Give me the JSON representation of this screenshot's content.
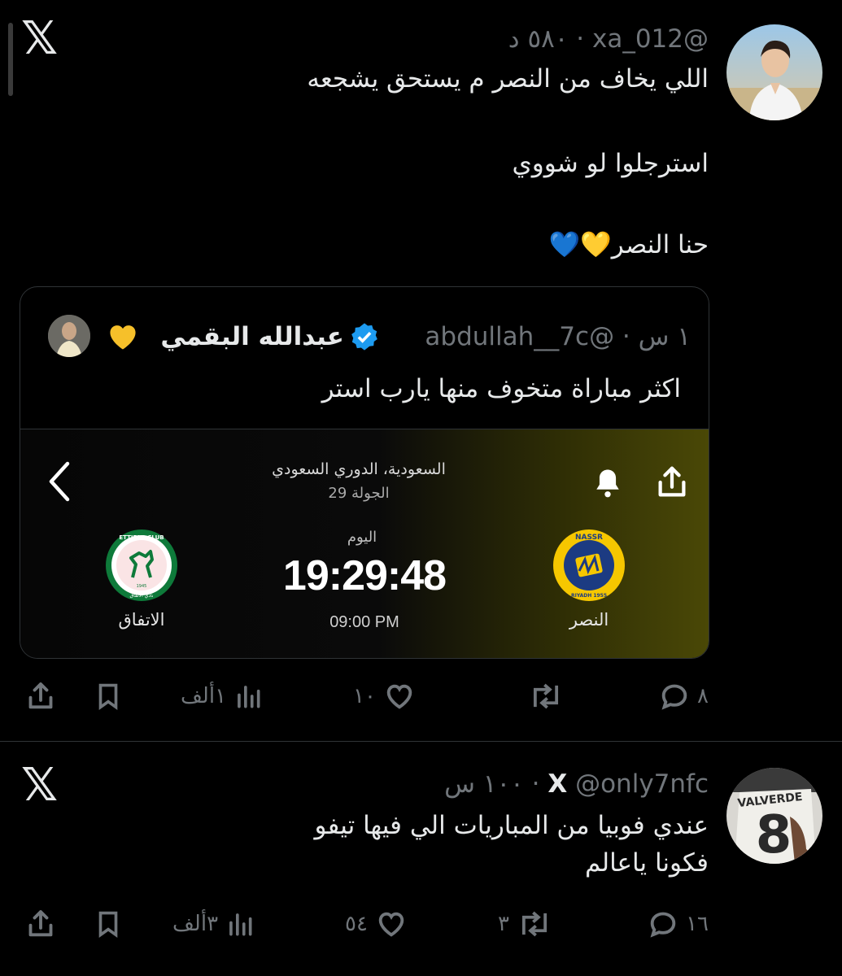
{
  "tweets": [
    {
      "handle": "@xa_012",
      "time": "٥٨٠ د",
      "sep": "·",
      "lines": [
        "اللي يخاف من النصر م يستحق يشجعه",
        "استرجلوا لو شووي",
        "حنا النصر💛💙"
      ],
      "quote": {
        "display_name": "عبدالله البقمي",
        "handle": "@abdullah__7c",
        "time": "١ س",
        "text": "اكثر مباراة متخوف منها يارب استر",
        "match": {
          "league": "السعودية، الدوري السعودي",
          "round": "الجولة 29",
          "day": "اليوم",
          "countdown": "19:29:48",
          "kickoff": "09:00 PM",
          "home_team": "النصر",
          "away_team": "الاتفاق",
          "home_badge_top": "NASSR",
          "home_badge_bottom": "RIYADH 1955",
          "away_badge_top": "ETTIFAQ CLUB",
          "away_badge_year": "1945",
          "away_badge_bottom": "نادي الاتفاق"
        }
      },
      "actions": {
        "replies": "٨",
        "retweets": "",
        "likes": "١٠",
        "views": "١ألف"
      }
    },
    {
      "handle": "@only7nfc",
      "time": "١٠٠ س",
      "sep": "·",
      "x_prefix": "X",
      "lines": [
        "عندي فوبيا من المباريات الي فيها تيفو",
        "فكونا ياعالم"
      ],
      "avatar_jersey_text": "VALVERDE",
      "avatar_jersey_number": "8",
      "actions": {
        "replies": "١٦",
        "retweets": "٣",
        "likes": "٥٤",
        "views": "٣ألف"
      }
    }
  ],
  "x_logo": "𝕏",
  "colors": {
    "verified": "#1d9bf0",
    "gold": "#f6c700",
    "nassr_blue": "#1c3b82",
    "ettifaq_green": "#0e7a3a"
  }
}
